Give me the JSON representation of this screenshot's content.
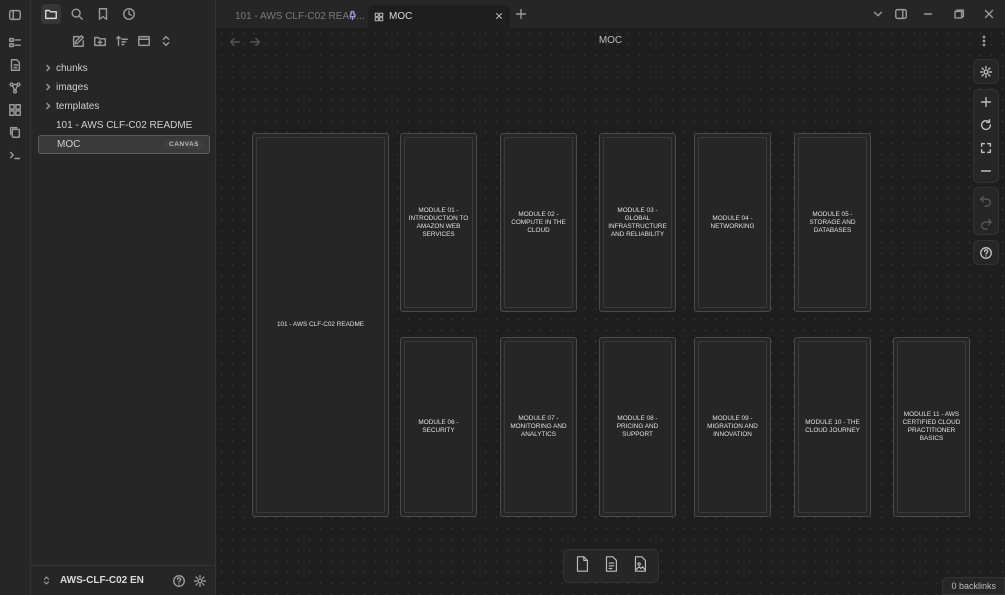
{
  "tabs": {
    "inactive_label": "101 - AWS CLF-C02 READ...",
    "active_label": "MOC"
  },
  "sidebar": {
    "items": [
      {
        "label": "chunks",
        "folder": true
      },
      {
        "label": "images",
        "folder": true
      },
      {
        "label": "templates",
        "folder": true
      },
      {
        "label": "101 - AWS CLF-C02 README",
        "folder": false
      },
      {
        "label": "MOC",
        "folder": false,
        "badge": "CANVAS",
        "active": true
      }
    ],
    "vault_name": "AWS-CLF-C02 EN"
  },
  "view": {
    "title": "MOC",
    "backlinks": "0 backlinks"
  },
  "canvas": {
    "nodes": [
      {
        "label": "101 - AWS CLF-C02 README"
      },
      {
        "label": "MODULE 01 - INTRODUCTION TO AMAZON WEB SERVICES"
      },
      {
        "label": "MODULE 02 - COMPUTE IN THE CLOUD"
      },
      {
        "label": "MODULE 03 - GLOBAL INFRASTRUCTURE AND RELIABILITY"
      },
      {
        "label": "MODULE 04 - NETWORKING"
      },
      {
        "label": "MODULE 05 - STORAGE AND DATABASES"
      },
      {
        "label": "MODULE 06 - SECURITY"
      },
      {
        "label": "MODULE 07 - MONITORING AND ANALYTICS"
      },
      {
        "label": "MODULE 08 - PRICING AND SUPPORT"
      },
      {
        "label": "MODULE 09 - MIGRATION AND INNOVATION"
      },
      {
        "label": "MODULE 10 - THE CLOUD JOURNEY"
      },
      {
        "label": "MODULE 11 - AWS CERTIFIED CLOUD PRACTITIONER BASICS"
      }
    ]
  },
  "colors": {
    "background": "#1e1e1e",
    "panel": "#262626",
    "pin_accent": "#a78bfa"
  }
}
